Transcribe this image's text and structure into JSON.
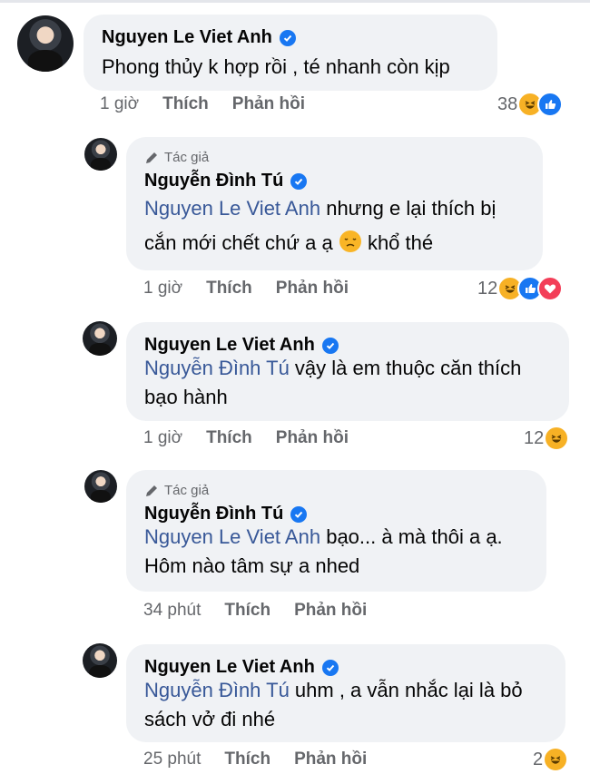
{
  "comments": [
    {
      "author": "Nguyen Le Viet Anh",
      "is_author": false,
      "author_tag": "",
      "mention": "",
      "text": "Phong thủy k hợp rồi , té nhanh còn kịp",
      "time": "1 giờ",
      "like_label": "Thích",
      "reply_label": "Phản hồi",
      "reaction_count": "38",
      "reactions": [
        "haha-icon",
        "like-icon"
      ]
    },
    {
      "author": "Nguyễn Đình Tú",
      "is_author": true,
      "author_tag": "Tác giả",
      "mention": "Nguyen Le Viet Anh",
      "text_line1": " nhưng e lại thích bị",
      "text_line2": "cắn mới chết chứ a ạ",
      "text_line2_end": " khổ thé",
      "time": "1 giờ",
      "like_label": "Thích",
      "reply_label": "Phản hồi",
      "reaction_count": "12",
      "reactions": [
        "haha-icon",
        "like-icon",
        "love-icon"
      ]
    },
    {
      "author": "Nguyen Le Viet Anh",
      "is_author": false,
      "author_tag": "",
      "mention": "Nguyễn Đình Tú",
      "text_line1": " vậy là em thuộc căn thích",
      "text_line2": "bạo hành",
      "time": "1 giờ",
      "like_label": "Thích",
      "reply_label": "Phản hồi",
      "reaction_count": "12",
      "reactions": [
        "haha-icon"
      ]
    },
    {
      "author": "Nguyễn Đình Tú",
      "is_author": true,
      "author_tag": "Tác giả",
      "mention": "Nguyen Le Viet Anh",
      "text_line1": " bạo... à mà thôi a ạ.",
      "text_line2": "Hôm nào tâm sự a nhed",
      "time": "34 phút",
      "like_label": "Thích",
      "reply_label": "Phản hồi",
      "reaction_count": "",
      "reactions": []
    },
    {
      "author": "Nguyen Le Viet Anh",
      "is_author": false,
      "author_tag": "",
      "mention": "Nguyễn Đình Tú",
      "text_line1": " uhm , a vẫn nhắc lại là bỏ",
      "text_line2": "sách vở đi nhé",
      "time": "25 phút",
      "like_label": "Thích",
      "reply_label": "Phản hồi",
      "reaction_count": "2",
      "reactions": [
        "haha-icon"
      ]
    }
  ],
  "colors": {
    "bubble": "#f0f2f5",
    "mention": "#385898",
    "verified": "#1877f2",
    "muted": "#65676b"
  }
}
